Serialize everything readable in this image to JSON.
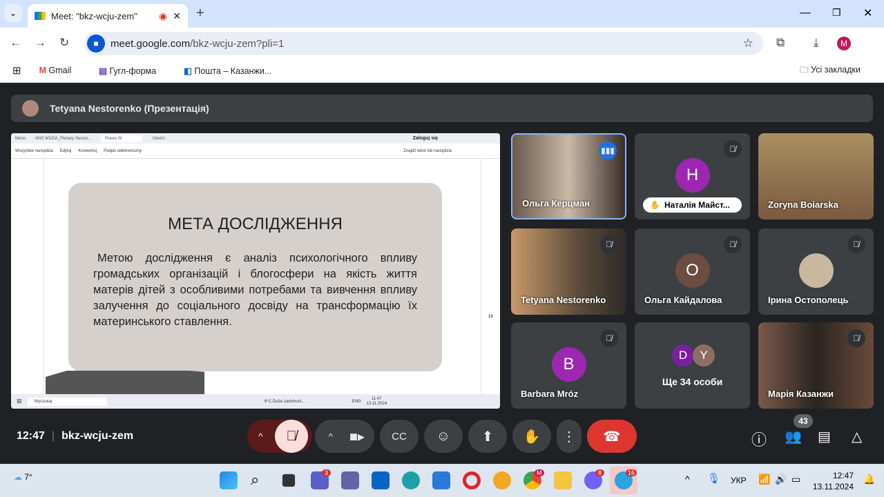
{
  "browser": {
    "tab_title": "Meet: \"bkz-wcju-zem\"",
    "url_host": "meet.google.com",
    "url_path": "/bkz-wcju-zem?pli=1",
    "profile_initial": "M",
    "bookmarks": [
      "Gmail",
      "Гугл-форма",
      "Пошта – Казанжи..."
    ],
    "all_bookmarks": "Усі закладки"
  },
  "presenter": {
    "label": "Tetyana Nestorenko (Презентація)"
  },
  "shared_screen": {
    "tabs": [
      "Menu",
      "ANS WSZiA_Plenary Sessio...",
      "Prawo W",
      "Utwórz"
    ],
    "login": "Zaloguj się",
    "menu": [
      "Wszystkie narzędzia",
      "Edytuj",
      "Konwertuj",
      "Podpis elektroniczny"
    ],
    "search": "Znajdź tekst lub narzędzia",
    "slide_title": "МЕТА ДОСЛІДЖЕННЯ",
    "slide_text": "Метою дослідження є аналіз психологічного впливу громадських організацій і блогосфери на якість життя матерів дітей з особливими потребами та вивчення впливу залучення до соціального досвіду на трансформацію їх материнського ставлення.",
    "page_num": "19",
    "taskbar_search": "Wyszukaj",
    "weather": "6°C Duże zachmurz...",
    "lang": "ENG",
    "time": "11:47",
    "date": "13.11.2024"
  },
  "participants": [
    {
      "name": "Ольга Керцман",
      "type": "video",
      "speaking": true
    },
    {
      "name": "Наталія Майст...",
      "letter": "H",
      "color": "#9c27b0",
      "hand": true
    },
    {
      "name": "Zoryna Boiarska",
      "type": "video"
    },
    {
      "name": "Tetyana Nestorenko",
      "type": "video"
    },
    {
      "name": "Ольга Кайдалова",
      "letter": "O",
      "color": "#6d4c41"
    },
    {
      "name": "Ірина Остополець",
      "type": "photo"
    },
    {
      "name": "Barbara Mróz",
      "letter": "B",
      "color": "#9c27b0"
    },
    {
      "name": "Ще 34 особи",
      "letters": [
        "D",
        "Y"
      ]
    },
    {
      "name": "Марія Казанжи",
      "type": "video"
    }
  ],
  "meeting": {
    "time": "12:47",
    "code": "bkz-wcju-zem",
    "participant_count": "43"
  },
  "windows": {
    "weather": "7°",
    "lang": "УКР",
    "time": "12:47",
    "date": "13.11.2024",
    "badges": {
      "teams": "3",
      "viber": "8",
      "telegram": "16",
      "chrome": "M"
    }
  }
}
